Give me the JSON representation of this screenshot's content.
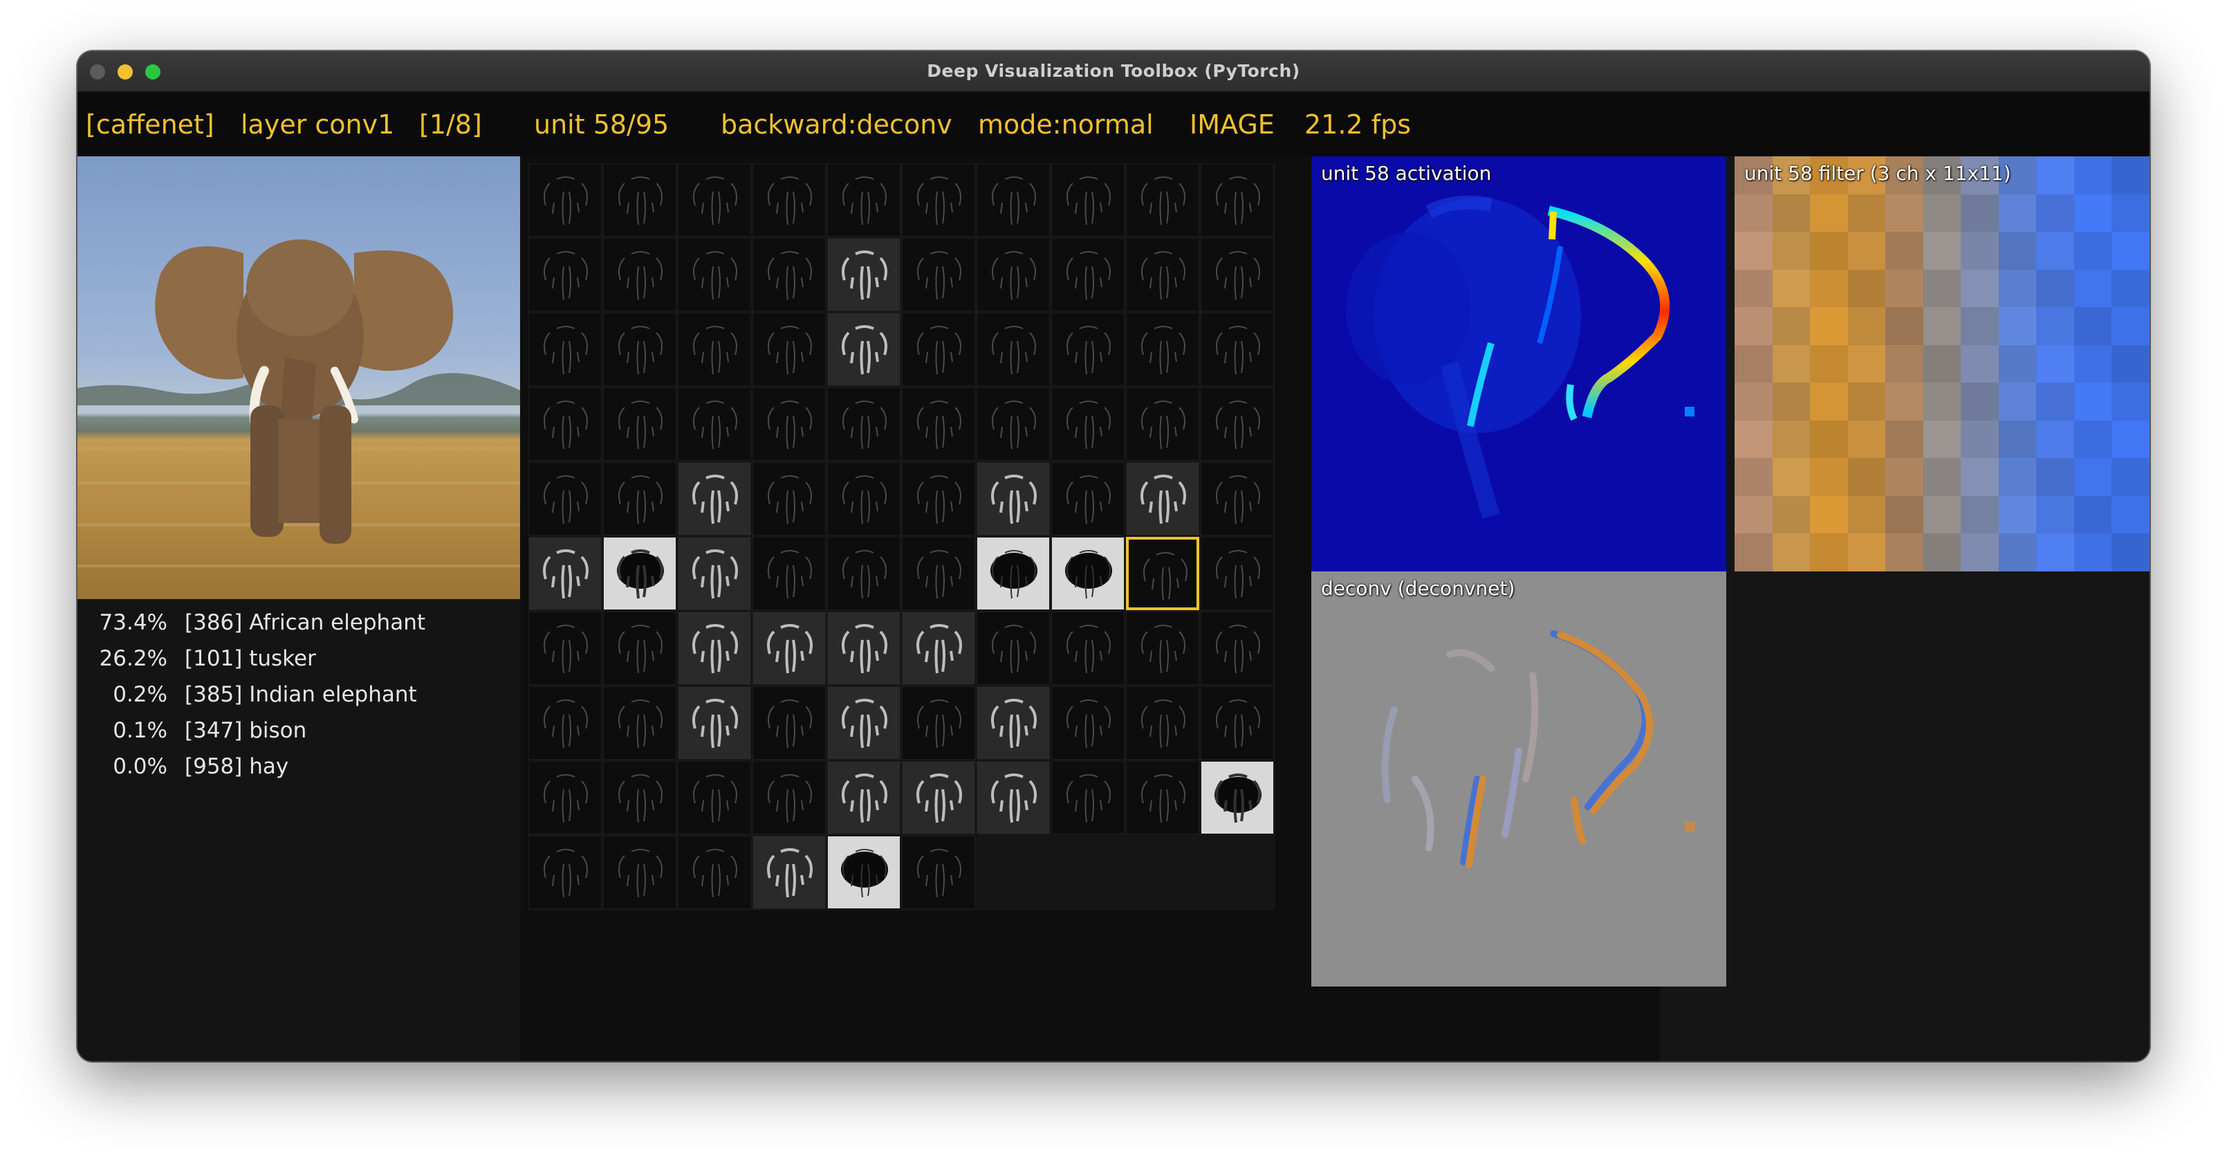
{
  "window": {
    "title": "Deep Visualization Toolbox (PyTorch)"
  },
  "status": {
    "model": "[caffenet]",
    "layer": "layer conv1",
    "layer_index": "[1/8]",
    "unit": "unit 58/95",
    "backward": "backward:deconv",
    "mode": "mode:normal",
    "input_mode": "IMAGE",
    "fps": "21.2 fps"
  },
  "predictions": [
    {
      "pct": "73.4%",
      "label": "[386] African elephant"
    },
    {
      "pct": "26.2%",
      "label": "[101] tusker"
    },
    {
      "pct": "0.2%",
      "label": "[385] Indian elephant"
    },
    {
      "pct": "0.1%",
      "label": "[347] bison"
    },
    {
      "pct": "0.0%",
      "label": "[958] hay"
    }
  ],
  "panels": {
    "activation_label": "unit 58 activation",
    "deconv_label": "deconv (deconvnet)",
    "filter_label": "unit 58 filter (3 ch x 11x11)"
  },
  "grid": {
    "columns": 10,
    "total_units": 96,
    "selected_unit": 58
  },
  "colors": {
    "accent": "#f2c12e",
    "activation_bg": "#0a0aa8",
    "deconv_bg": "#8e8e8e"
  },
  "icons": {
    "close": "close-dot",
    "minimize": "minimize-dot",
    "maximize": "maximize-dot"
  }
}
